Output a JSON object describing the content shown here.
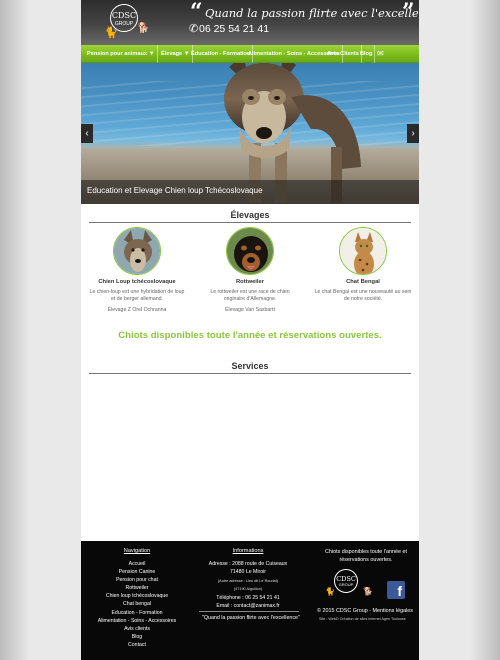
{
  "header": {
    "logo_main": "CDSC",
    "logo_sub": "GROUP",
    "slogan": "Quand la passion flirte avec l'excellence",
    "phone": "06 25 54 21 41"
  },
  "nav": {
    "items": [
      {
        "label": "Pension pour animaux",
        "has_caret": "▼"
      },
      {
        "label": "Élevage",
        "has_caret": "▼"
      },
      {
        "label": "Éducation - Formation"
      },
      {
        "label": "Alimentation - Soins - Accessoires"
      },
      {
        "label": "Avis Clients"
      },
      {
        "label": "Blog"
      }
    ],
    "mail_icon": "envelope-icon"
  },
  "hero": {
    "caption": "Education et Elevage Chien loup Tchécoslovaque",
    "prev_icon": "‹",
    "next_icon": "›"
  },
  "elevages": {
    "title": "Élevages",
    "items": [
      {
        "name": "Chien Loup tchécoslovaque",
        "desc": "Le chien-loup est une hybridation de loup et de berger allemand.",
        "extra": "Élevage Z Orel Ochranna"
      },
      {
        "name": "Rottweiler",
        "desc": "Le rottweiler est une race de chien originaire d'Allemagne.",
        "extra": "Élevage Van Saxbartt"
      },
      {
        "name": "Chat Bengal",
        "desc": "Le chat Bengal est une nouveauté au sein de notre société."
      }
    ]
  },
  "dispo": "Chiots disponibles toute l'année et réservations ouvertes.",
  "services": {
    "title": "Services"
  },
  "footer": {
    "nav_title": "Navigation",
    "nav_links": [
      "Accueil",
      "Pension Canine",
      "Pension pour chat",
      "Rottweiler",
      "Chien loup tchécoslovaque",
      "Chat bengal",
      "Education - Formation",
      "Alimentation - Soins - Accessoires",
      "Avis clients",
      "Blog",
      "Contact"
    ],
    "info_title": "Informations",
    "address": "Adresse : 2088 route de Cuiseaux",
    "city": "71480 Le Miroir",
    "old_address": "(Autre adresse : Lieu dit Le Roudat)",
    "old_city": "(47190 Aiguillon)",
    "phone": "Téléphone : 06 25 54 21 41",
    "email": "Email : contact@zanimax.fr",
    "quote": "\"Quand la passion flirte avec l'excellence\"",
    "dispo": "Chiots disponibles toute l'année et réservations ouvertes.",
    "logo_main": "CDSC",
    "logo_sub": "GROUP",
    "copyright": "© 2015 CDSC Group - Mentions légales",
    "credit": "Site : WebD Création de sites internet Agen Toulouse",
    "fb_letter": "f"
  },
  "colors": {
    "accent": "#8cc63f",
    "footer_bg": "#080808",
    "nav_green": "#7fbf1e"
  }
}
